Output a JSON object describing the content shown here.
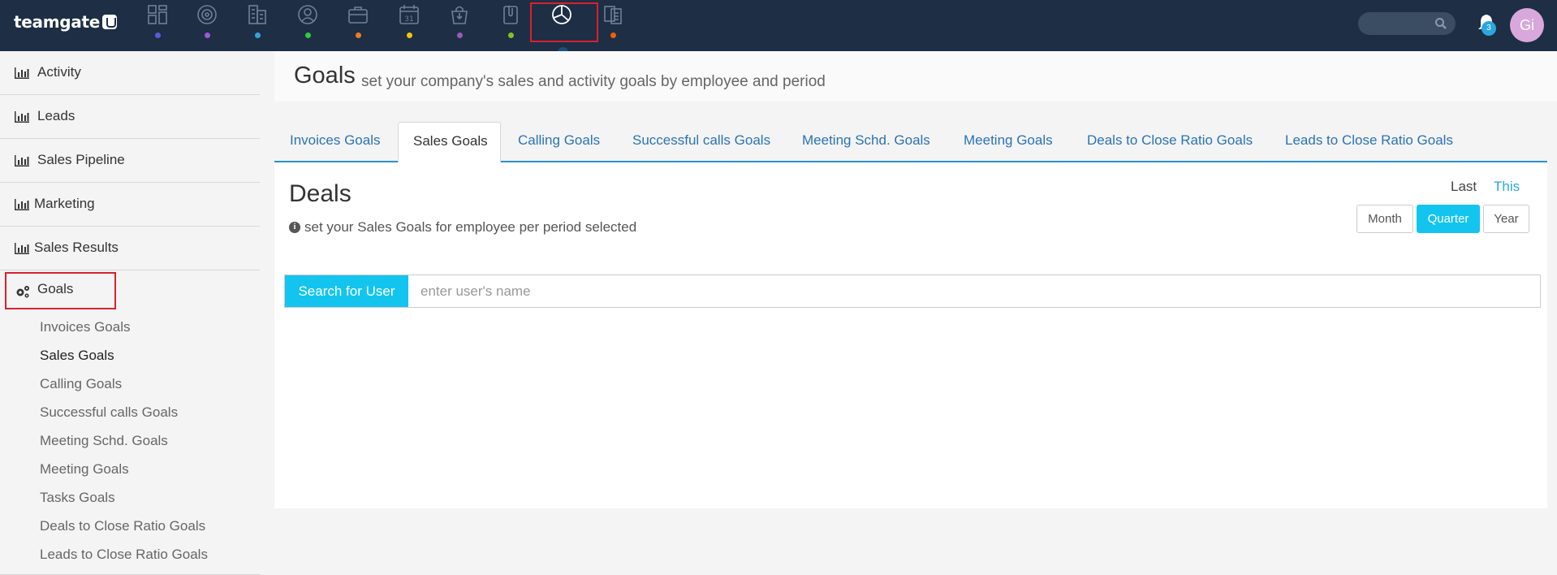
{
  "app": {
    "logo_text": "teamgate",
    "nav_icons": [
      {
        "name": "dashboard-icon",
        "dot_color": "#5b5bd6"
      },
      {
        "name": "target-icon",
        "dot_color": "#9b59d6"
      },
      {
        "name": "buildings-icon",
        "dot_color": "#3aa0d8"
      },
      {
        "name": "contacts-icon",
        "dot_color": "#2ecc40"
      },
      {
        "name": "briefcase-icon",
        "dot_color": "#e67e22"
      },
      {
        "name": "calendar-icon",
        "dot_color": "#f1c40f"
      },
      {
        "name": "shopping-bag-icon",
        "dot_color": "#9b59b6"
      },
      {
        "name": "attachment-icon",
        "dot_color": "#7fc31c"
      },
      {
        "name": "pie-chart-icon",
        "dot_color": ""
      },
      {
        "name": "documents-icon",
        "dot_color": "#e8620c"
      }
    ],
    "calendar_day": "31",
    "notifications_count": "3",
    "avatar_initials": "Gi"
  },
  "sidebar": {
    "items": [
      {
        "label": "Activity",
        "icon": "bar-chart-icon"
      },
      {
        "label": "Leads",
        "icon": "bar-chart-icon"
      },
      {
        "label": "Sales Pipeline",
        "icon": "bar-chart-icon"
      },
      {
        "label": "Marketing",
        "icon": "bar-chart-icon"
      },
      {
        "label": "Sales Results",
        "icon": "bar-chart-icon"
      },
      {
        "label": "Goals",
        "icon": "gears-icon"
      }
    ],
    "goals_subitems": [
      "Invoices Goals",
      "Sales Goals",
      "Calling Goals",
      "Successful calls Goals",
      "Meeting Schd. Goals",
      "Meeting Goals",
      "Tasks Goals",
      "Deals to Close Ratio Goals",
      "Leads to Close Ratio Goals"
    ],
    "active_subitem": "Sales Goals"
  },
  "header": {
    "title": "Goals",
    "subtitle": "set your company's sales and activity goals by employee and period"
  },
  "tabs": [
    "Invoices Goals",
    "Sales Goals",
    "Calling Goals",
    "Successful calls Goals",
    "Meeting Schd. Goals",
    "Meeting Goals",
    "Deals to Close Ratio Goals",
    "Leads to Close Ratio Goals"
  ],
  "active_tab": "Sales Goals",
  "panel": {
    "title": "Deals",
    "hint": "set your Sales Goals for employee per period selected",
    "last_label": "Last",
    "this_label": "This",
    "period_buttons": [
      "Month",
      "Quarter",
      "Year"
    ],
    "active_period": "Quarter",
    "search_button": "Search for User",
    "search_placeholder": "enter user's name"
  },
  "colors": {
    "topbar": "#1d2e45",
    "accent": "#13c5ee",
    "link": "#2b73b5",
    "highlight": "#d9202f"
  }
}
